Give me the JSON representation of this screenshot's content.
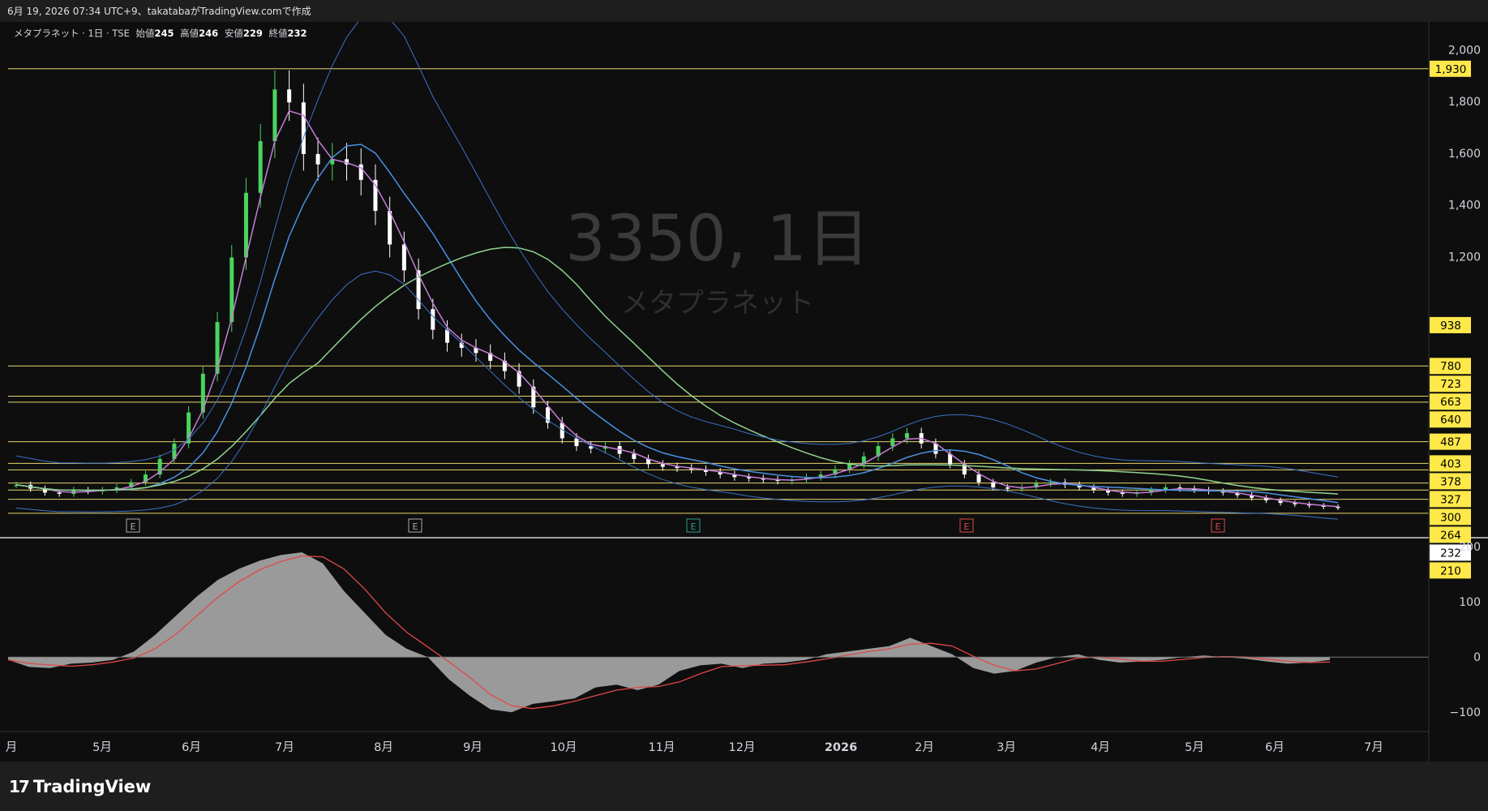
{
  "header": {
    "caption": "6月 19, 2026 07:34 UTC+9、takatabaがTradingView.comで作成"
  },
  "legend": {
    "name": "メタプラネット · 1日 · TSE",
    "open_label": "始値",
    "open": "245",
    "high_label": "高値",
    "high": "246",
    "low_label": "安値",
    "low": "229",
    "close_label": "終値",
    "close": "232"
  },
  "watermark": {
    "symbol": "3350, 1日",
    "name": "メタプラネット"
  },
  "brand": {
    "name": "TradingView"
  },
  "colors": {
    "background": "#0e0e0e",
    "up_candle": "#4bd35e",
    "down_candle": "#ffffff",
    "sma_short": "#c77dd8",
    "sma_mid": "#4a90e2",
    "sma_long": "#8fd38f",
    "bollinger": "#3b73c9",
    "horizontal_lines": "#e8d36a",
    "price_tag": "#ffe94a",
    "macd_signal": "#e04848",
    "macd_hist": "#9a9a9a"
  },
  "chart_data": [
    {
      "type": "candlestick",
      "ticker": "3350",
      "axis_y": {
        "ticks": [
          "2,000",
          "1,800",
          "1,600",
          "1,400",
          "1,200"
        ],
        "tick_values": [
          2000,
          1800,
          1600,
          1400,
          1200
        ],
        "ylim": [
          150,
          2080
        ]
      },
      "axis_x": {
        "ticks": [
          "月",
          "5月",
          "6月",
          "7月",
          "8月",
          "9月",
          "10月",
          "11月",
          "12月",
          "2026",
          "2月",
          "3月",
          "4月",
          "5月",
          "6月",
          "7月"
        ]
      },
      "level_lines": [
        1930,
        780,
        663,
        640,
        487,
        403,
        378,
        327,
        300,
        264,
        210
      ],
      "price_tags": [
        "1,930",
        "938",
        "780",
        "723",
        "663",
        "640",
        "487",
        "403",
        "378",
        "327",
        "300",
        "264",
        "232",
        "210"
      ],
      "last_price": "232",
      "earnings_markers": [
        "E",
        "E",
        "E",
        "E",
        "E"
      ],
      "close_series_approx": [
        320,
        305,
        290,
        285,
        300,
        295,
        300,
        310,
        330,
        360,
        420,
        480,
        600,
        750,
        950,
        1200,
        1450,
        1650,
        1850,
        1800,
        1600,
        1560,
        1580,
        1560,
        1500,
        1380,
        1250,
        1150,
        1000,
        920,
        870,
        850,
        830,
        800,
        760,
        700,
        620,
        560,
        500,
        470,
        460,
        470,
        440,
        420,
        400,
        390,
        385,
        380,
        370,
        360,
        350,
        345,
        340,
        335,
        340,
        350,
        360,
        380,
        400,
        430,
        470,
        500,
        520,
        480,
        440,
        400,
        360,
        330,
        310,
        305,
        310,
        325,
        330,
        320,
        310,
        300,
        290,
        285,
        290,
        300,
        310,
        305,
        300,
        295,
        290,
        280,
        270,
        260,
        250,
        245,
        240,
        235,
        232
      ]
    },
    {
      "type": "area",
      "indicator": "MACD",
      "axis_y": {
        "ticks": [
          "200",
          "100",
          "0",
          "−100"
        ],
        "tick_values": [
          200,
          100,
          0,
          -100
        ],
        "ylim": [
          -135,
          215
        ]
      },
      "histogram_approx": [
        -5,
        -18,
        -20,
        -12,
        -10,
        -5,
        10,
        40,
        75,
        110,
        140,
        160,
        175,
        185,
        190,
        170,
        120,
        80,
        40,
        15,
        0,
        -40,
        -70,
        -95,
        -100,
        -85,
        -80,
        -75,
        -55,
        -50,
        -60,
        -50,
        -25,
        -15,
        -12,
        -20,
        -12,
        -10,
        -5,
        5,
        10,
        15,
        20,
        35,
        20,
        5,
        -20,
        -30,
        -25,
        -10,
        0,
        5,
        -5,
        -10,
        -8,
        -5,
        0,
        3,
        0,
        -3,
        -8,
        -12,
        -10,
        -5
      ]
    }
  ]
}
